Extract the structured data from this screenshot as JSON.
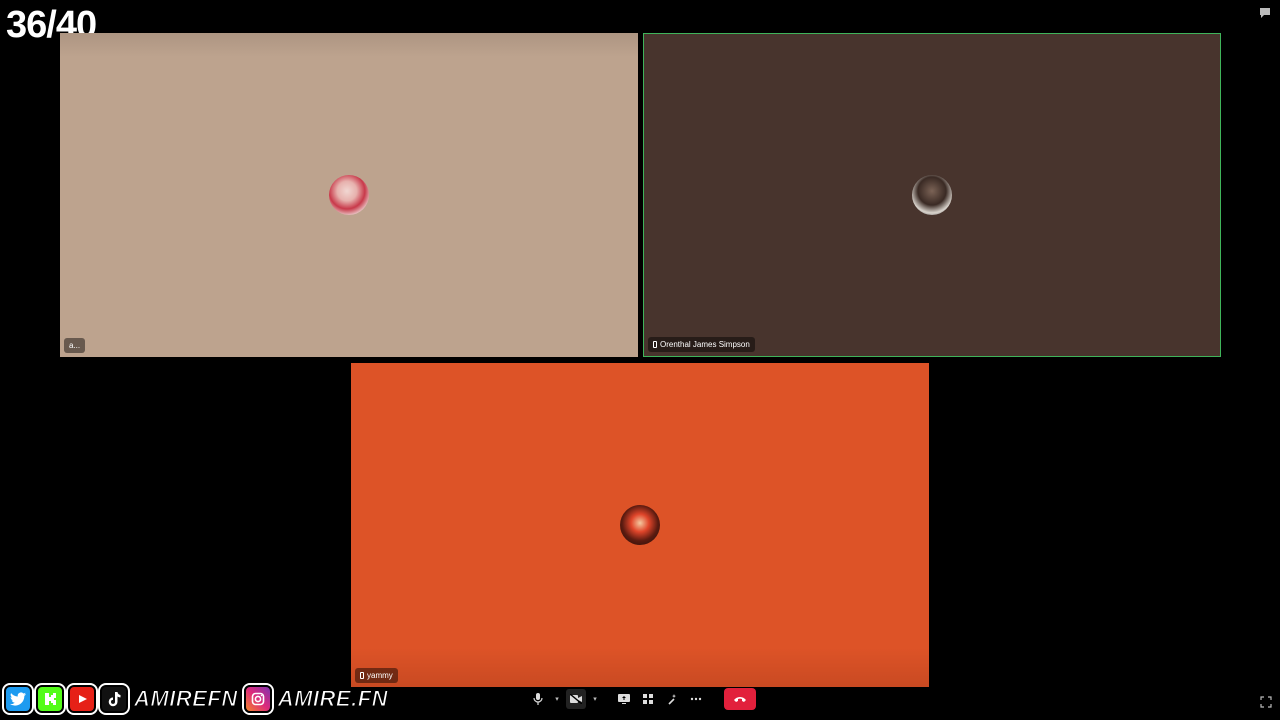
{
  "overlay": {
    "counter": "36/40"
  },
  "tiles": [
    {
      "name": "a...",
      "avatar_icon": "user-avatar-1",
      "bg": "#bda38e"
    },
    {
      "name": "Orenthal James Simpson",
      "avatar_icon": "user-avatar-2",
      "bg": "#48342d",
      "active_speaker": true
    },
    {
      "name": "yammy",
      "avatar_icon": "user-avatar-3",
      "bg": "#dd5327"
    }
  ],
  "socials": {
    "handle1": "AMIREFN",
    "handle2": "AMIRE.FN",
    "icons": [
      "twitter-icon",
      "kick-icon",
      "youtube-icon",
      "tiktok-icon",
      "instagram-icon"
    ]
  },
  "controls": {
    "buttons": [
      "microphone-icon",
      "camera-icon",
      "share-screen-icon",
      "apps-icon",
      "effects-icon",
      "more-icon",
      "hang-up-icon"
    ]
  },
  "colors": {
    "accent_green": "#3fb45a",
    "hangup_red": "#e2203c"
  }
}
